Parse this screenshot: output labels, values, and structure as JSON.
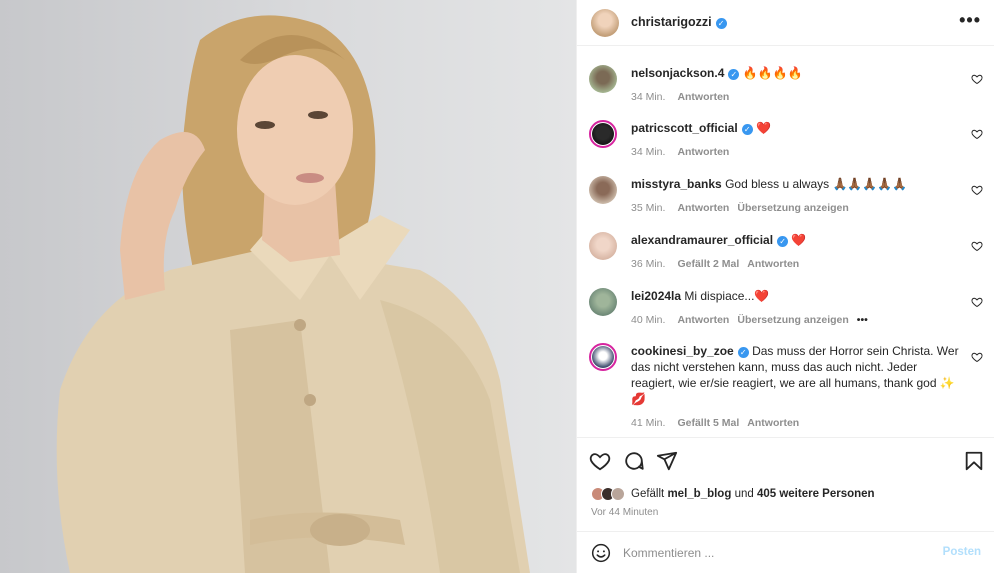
{
  "post": {
    "author": "christarigozzi",
    "author_verified": true,
    "more_icon": "more-horizontal-icon"
  },
  "comments": [
    {
      "username": "nelsonjackson.4",
      "verified": true,
      "text": "🔥🔥🔥🔥",
      "time": "34 Min.",
      "likes": "",
      "reply": "Antworten",
      "translate": ""
    },
    {
      "username": "patricscott_official",
      "verified": true,
      "text": "❤️",
      "time": "34 Min.",
      "likes": "",
      "reply": "Antworten",
      "translate": ""
    },
    {
      "username": "misstyra_banks",
      "verified": false,
      "text": "God bless u always 🙏🏾🙏🏾🙏🏾🙏🏾🙏🏾",
      "time": "35 Min.",
      "likes": "",
      "reply": "Antworten",
      "translate": "Übersetzung anzeigen"
    },
    {
      "username": "alexandramaurer_official",
      "verified": true,
      "text": "❤️",
      "time": "36 Min.",
      "likes": "Gefällt 2 Mal",
      "reply": "Antworten",
      "translate": ""
    },
    {
      "username": "lei2024la",
      "verified": false,
      "text": "Mi dispiace...❤️",
      "time": "40 Min.",
      "likes": "",
      "reply": "Antworten",
      "translate": "Übersetzung anzeigen",
      "more": "•••"
    },
    {
      "username": "cookinesi_by_zoe",
      "verified": true,
      "text": "Das muss der Horror sein Christa. Wer das nicht verstehen kann, muss das auch nicht. Jeder reagiert, wie er/sie reagiert, we are all humans, thank god ✨💋",
      "time": "41 Min.",
      "likes": "Gefällt 5 Mal",
      "reply": "Antworten",
      "translate": ""
    }
  ],
  "actions": {
    "icons": [
      "heart-icon",
      "comment-icon",
      "share-icon",
      "bookmark-icon"
    ],
    "liked_by_prefix": "Gefällt",
    "liked_by_user": "mel_b_blog",
    "liked_by_and": "und",
    "liked_by_others": "405 weitere Personen",
    "time_ago": "Vor 44 Minuten"
  },
  "composer": {
    "placeholder": "Kommentieren ...",
    "post_label": "Posten"
  },
  "colors": {
    "verified": "#3897f0",
    "secondary_text": "#8e8e8e",
    "post_disabled": "#b2dffc",
    "heart_red": "#ed4956"
  }
}
